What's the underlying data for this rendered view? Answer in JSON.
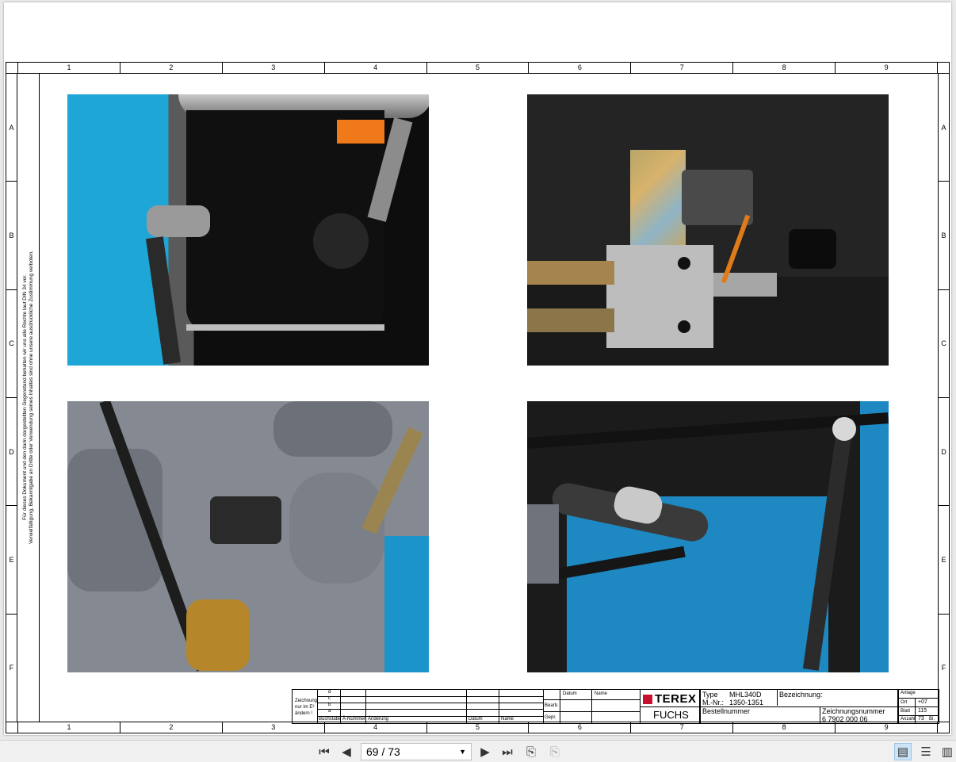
{
  "grid": {
    "columns": [
      "1",
      "2",
      "3",
      "4",
      "5",
      "6",
      "7",
      "8",
      "9"
    ],
    "rows": [
      "A",
      "B",
      "C",
      "D",
      "E",
      "F"
    ]
  },
  "side_note": {
    "line1": "Für dieses Dokument und den darin dargestellten Gegenstand behalten wir uns alle Rechte laut DIN 34 vor.",
    "line2": "Vervielfältigung, Bekanntgabe an Dritte oder Verwendung seines Inhaltes sind ohne unsere ausdrückliche Zustimmung verboten."
  },
  "photos": [
    {
      "subject": "lubrication pump reservoir on blue frame"
    },
    {
      "subject": "hydraulic solenoid valve block with orange wire"
    },
    {
      "subject": "grey hydraulic pumps with corrugated cable"
    },
    {
      "subject": "hoses and cable harness over blue frame"
    }
  ],
  "title_block": {
    "zeichnung_note": [
      "Zeichnung",
      "nur im E³",
      "ändern !"
    ],
    "change_rows": [
      "d",
      "c",
      "b",
      "a"
    ],
    "col_buchstabe": "Buchstabe",
    "col_anummer": "Ä-Nummer",
    "col_aenderung": "Änderung",
    "col_datum": "Datum",
    "col_name": "Name",
    "datum_label": "Datum",
    "name_label": "Name",
    "bearb": "Bearb.",
    "gepr": "Gepr.",
    "logo_terex": "TEREX",
    "logo_fuchs": "FUCHS",
    "type_label": "Type",
    "type_value": "MHL340D",
    "mnr_label": "M.-Nr.:",
    "mnr_value": "1350-1351",
    "bezeichnung_label": "Bezeichnung:",
    "bestellnummer_label": "Bestellnummer",
    "zeichnungsnummer_label": "Zeichnungsnummer",
    "zeichnungsnummer_value": "6 7902 000 06",
    "anlage_label": "Anlage",
    "ort_label": "Ort",
    "ort_value": "+07",
    "blatt_label": "Blatt",
    "blatt_value": "115",
    "anzahl_label": "Anzahl",
    "anzahl_value": "73",
    "bl_label": "Bl."
  },
  "viewer": {
    "page_indicator": "69 / 73"
  }
}
